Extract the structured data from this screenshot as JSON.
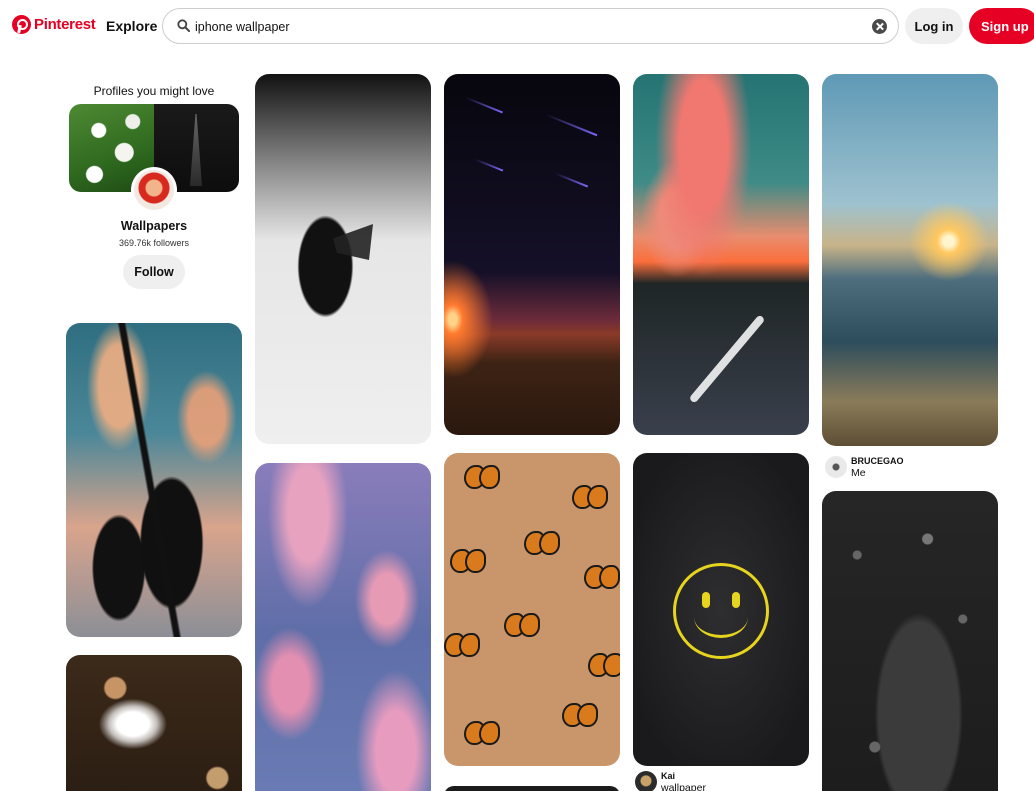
{
  "header": {
    "brand": "Pinterest",
    "explore_label": "Explore",
    "search_value": "iphone wallpaper",
    "login_label": "Log in",
    "signup_label": "Sign up"
  },
  "profiles": {
    "title": "Profiles you might love",
    "name": "Wallpapers",
    "followers": "369.76k followers",
    "follow_label": "Follow"
  },
  "creators": [
    {
      "name": "BRUCEGAO",
      "sub": "Me"
    },
    {
      "name": "Kai",
      "sub": "wallpaper"
    }
  ],
  "colors": {
    "brand_red": "#e60023",
    "button_gray": "#efefef"
  }
}
